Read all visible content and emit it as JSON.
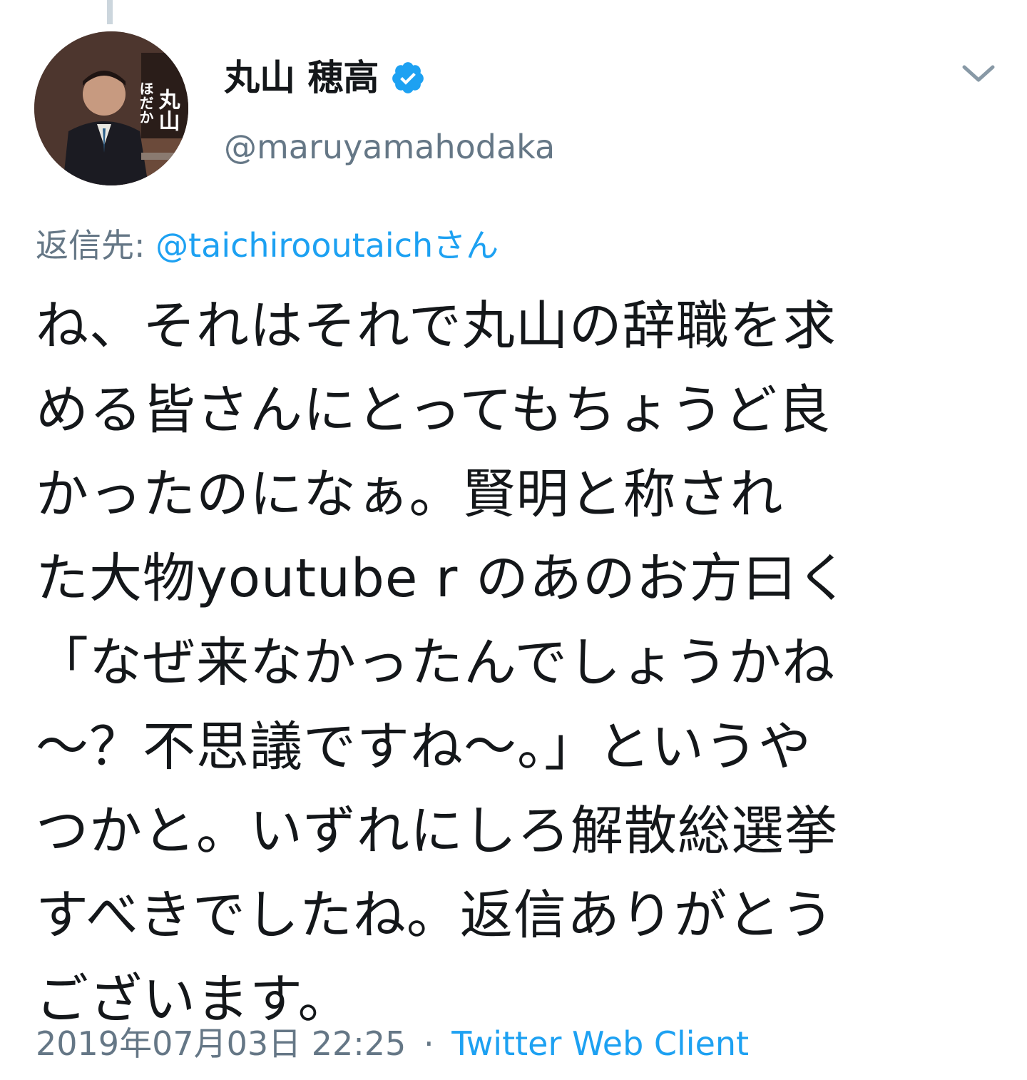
{
  "tweet": {
    "author": {
      "display_name": "丸山 穂高",
      "handle": "@maruyamahodaka",
      "verified": true,
      "avatar_text": [
        "丸山",
        "ほだか"
      ]
    },
    "reply_to": {
      "label": "返信先:",
      "handle": "@taichirooutaichさん"
    },
    "text_lines": [
      "ね、それはそれで丸山の辞職を求",
      "める皆さんにとってもちょうど良",
      "かったのになぁ。賢明と称され",
      "た大物youtube r のあのお方曰く",
      "「なぜ来なかったんでしょうかね",
      "〜？不思議ですね〜。」というや",
      "つかと。いずれにしろ解散総選挙",
      "すべきでしたね。返信ありがとう",
      "ございます。"
    ],
    "timestamp": "2019年07月03日 22:25",
    "separator": "·",
    "client": "Twitter Web Client"
  },
  "colors": {
    "accent": "#1da1f2",
    "secondary_text": "#657786",
    "primary_text": "#14171a",
    "thread_line": "#ccd6dd"
  },
  "icons": {
    "verified": "verified-badge-icon",
    "menu": "chevron-down-icon"
  }
}
